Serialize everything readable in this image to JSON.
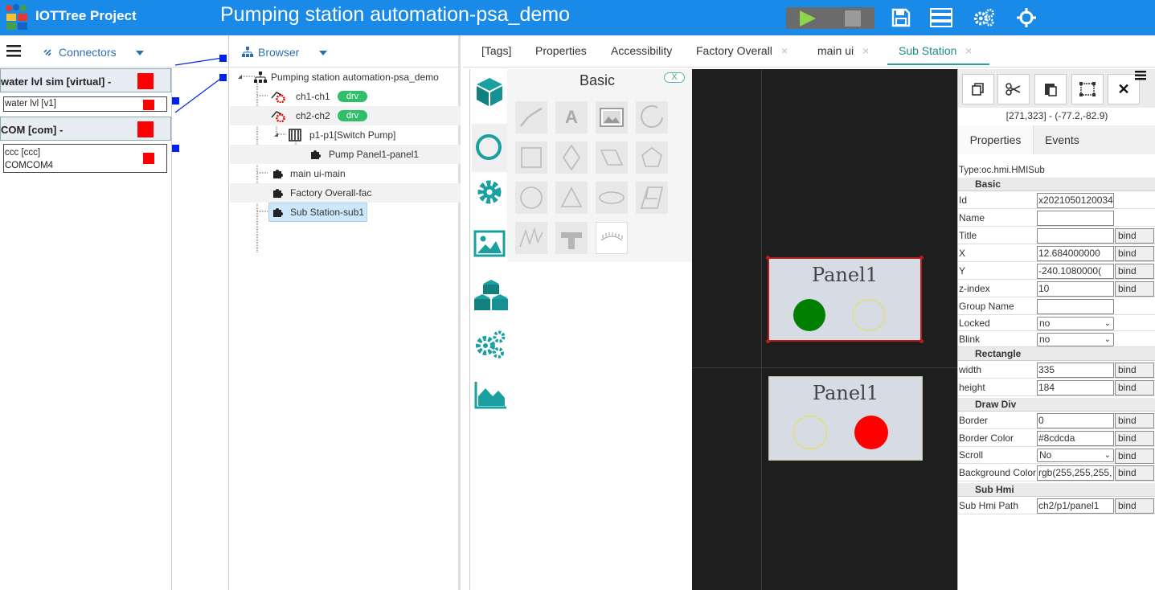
{
  "header": {
    "app_title": "IOTTree Project",
    "page_title": "Pumping station automation-psa_demo"
  },
  "left": {
    "connectors_label": "Connectors",
    "items": [
      {
        "label": "water lvl sim [virtual]",
        "suffix": "-",
        "sub": [
          "water lvl [v1]"
        ]
      },
      {
        "label": "COM [com]",
        "suffix": "-",
        "sub": [
          "ccc [ccc]",
          "COMCOM4"
        ]
      }
    ]
  },
  "browser": {
    "label": "Browser",
    "tree": [
      {
        "text": "Pumping station automation-psa_demo"
      },
      {
        "text": "ch1-ch1",
        "badge": "drv"
      },
      {
        "text": "ch2-ch2",
        "badge": "drv"
      },
      {
        "text": "p1-p1[Switch Pump]"
      },
      {
        "text": "Pump Panel1-panel1"
      },
      {
        "text": "main ui-main"
      },
      {
        "text": "Factory Overall-fac"
      },
      {
        "text": "Sub Station-sub1"
      }
    ]
  },
  "tabs": [
    {
      "label": "[Tags]"
    },
    {
      "label": "Properties"
    },
    {
      "label": "Accessibility"
    },
    {
      "label": "Factory Overall",
      "close": "×"
    },
    {
      "label": "main ui",
      "close": "×"
    },
    {
      "label": "Sub Station",
      "close": "×",
      "active": true
    }
  ],
  "basic": {
    "title": "Basic",
    "close": "X",
    "shapes": [
      "line-icon",
      "text-icon",
      "image-icon",
      "arc-icon",
      "square-icon",
      "diamond-icon",
      "parallelogram-icon",
      "pentagon-icon",
      "circle-icon",
      "triangle-icon",
      "ellipse-icon",
      "trapezoid-icon",
      "wave-icon",
      "pipe-icon",
      "gauge-icon"
    ]
  },
  "canvas": {
    "panel1_label": "Panel1",
    "panel2_label": "Panel1",
    "colors": {
      "green": "#008000",
      "red": "#ff0000",
      "outline": "#e8e04a"
    }
  },
  "props": {
    "coord": "[271,323] - (-77.2,-82.9)",
    "tab_properties": "Properties",
    "tab_events": "Events",
    "type": "Type:oc.hmi.HMISub",
    "sections": {
      "basic": "Basic",
      "rectangle": "Rectangle",
      "draw_div": "Draw Div",
      "sub_hmi": "Sub Hmi"
    },
    "bind_label": "bind",
    "rows": {
      "id": {
        "label": "Id",
        "value": "x2021050120034"
      },
      "name": {
        "label": "Name",
        "value": ""
      },
      "title": {
        "label": "Title",
        "value": ""
      },
      "x": {
        "label": "X",
        "value": "12.684000000"
      },
      "y": {
        "label": "Y",
        "value": "-240.1080000("
      },
      "zindex": {
        "label": "z-index",
        "value": "10"
      },
      "group": {
        "label": "Group Name",
        "value": ""
      },
      "locked": {
        "label": "Locked",
        "value": "no"
      },
      "blink": {
        "label": "Blink",
        "value": "no"
      },
      "width": {
        "label": "width",
        "value": "335"
      },
      "height": {
        "label": "height",
        "value": "184"
      },
      "border": {
        "label": "Border",
        "value": "0"
      },
      "border_color": {
        "label": "Border Color",
        "value": "#8cdcda"
      },
      "scroll": {
        "label": "Scroll",
        "value": "No"
      },
      "bg_color": {
        "label": "Background Color",
        "value": "rgb(255,255,255,"
      },
      "sub_path": {
        "label": "Sub Hmi Path",
        "value": "ch2/p1/panel1"
      }
    }
  }
}
